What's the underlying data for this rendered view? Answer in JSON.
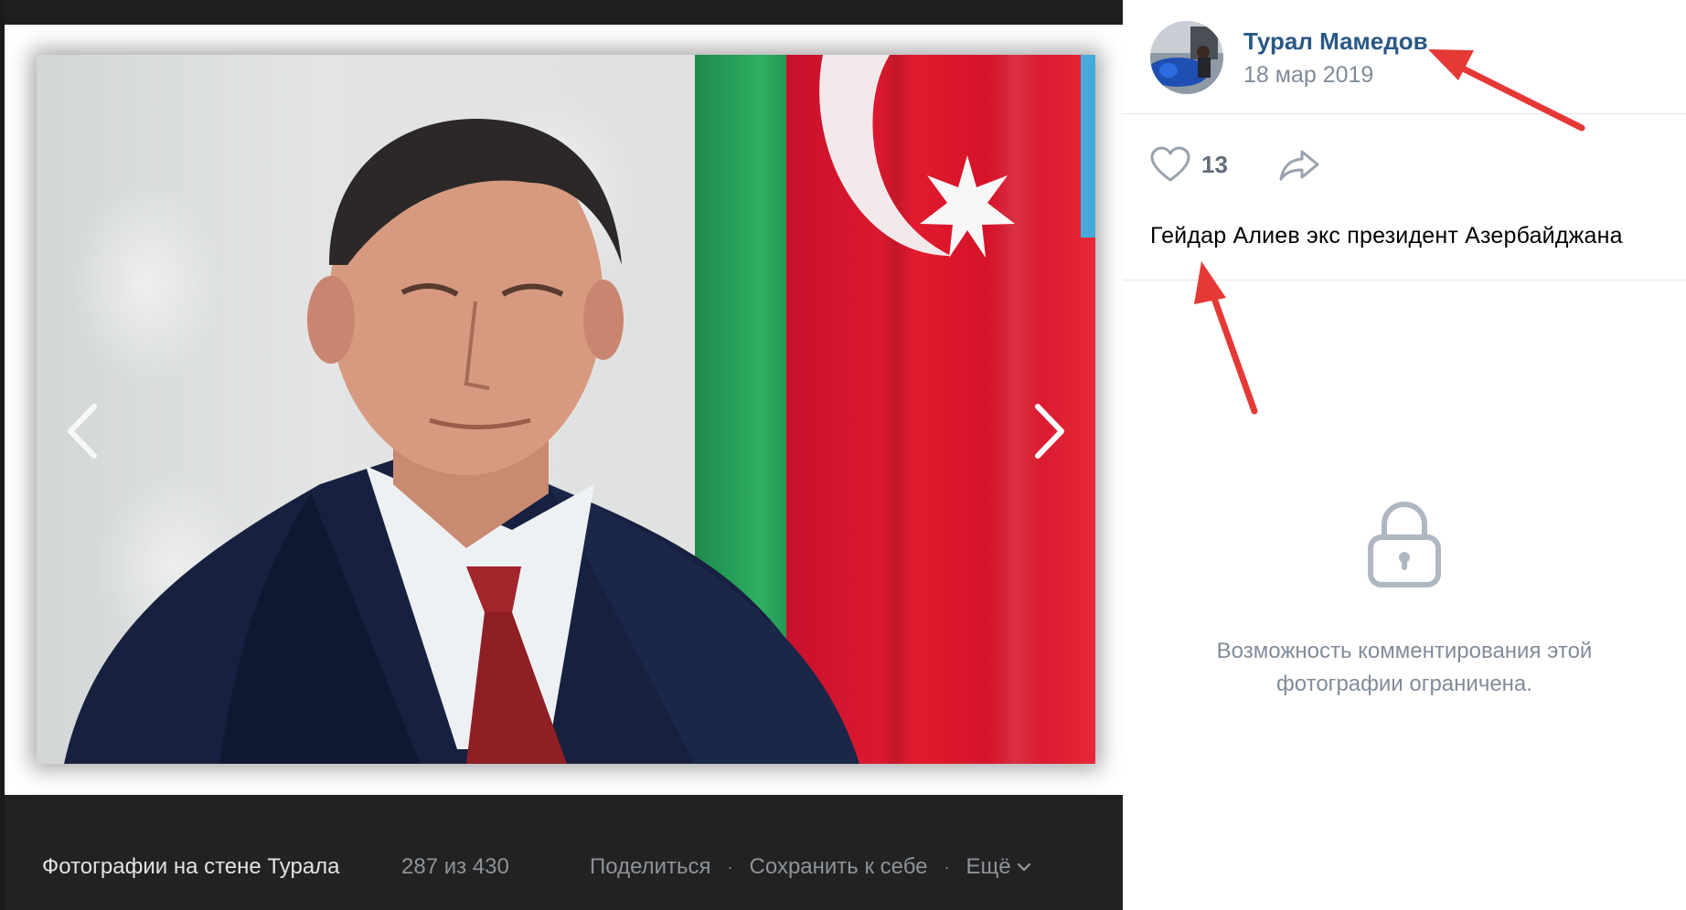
{
  "viewer": {
    "album_title": "Фотографии на стене Турала",
    "counter": "287 из 430",
    "actions": {
      "share": "Поделиться",
      "save": "Сохранить к себе",
      "more": "Ещё"
    },
    "separator": "·"
  },
  "post": {
    "author_name": "Турал Мамедов",
    "date": "18 мар 2019",
    "likes": "13",
    "caption": "Гейдар Алиев экс президент Азербайджана",
    "comments_restricted": "Возможность комментирования этой фотографии ограничена."
  },
  "colors": {
    "link": "#2a5885",
    "muted": "#818c99",
    "annotation_arrow": "#e53935"
  },
  "icons": [
    "chevron-left-icon",
    "chevron-right-icon",
    "heart-icon",
    "share-icon",
    "lock-icon",
    "chevron-down-icon"
  ]
}
